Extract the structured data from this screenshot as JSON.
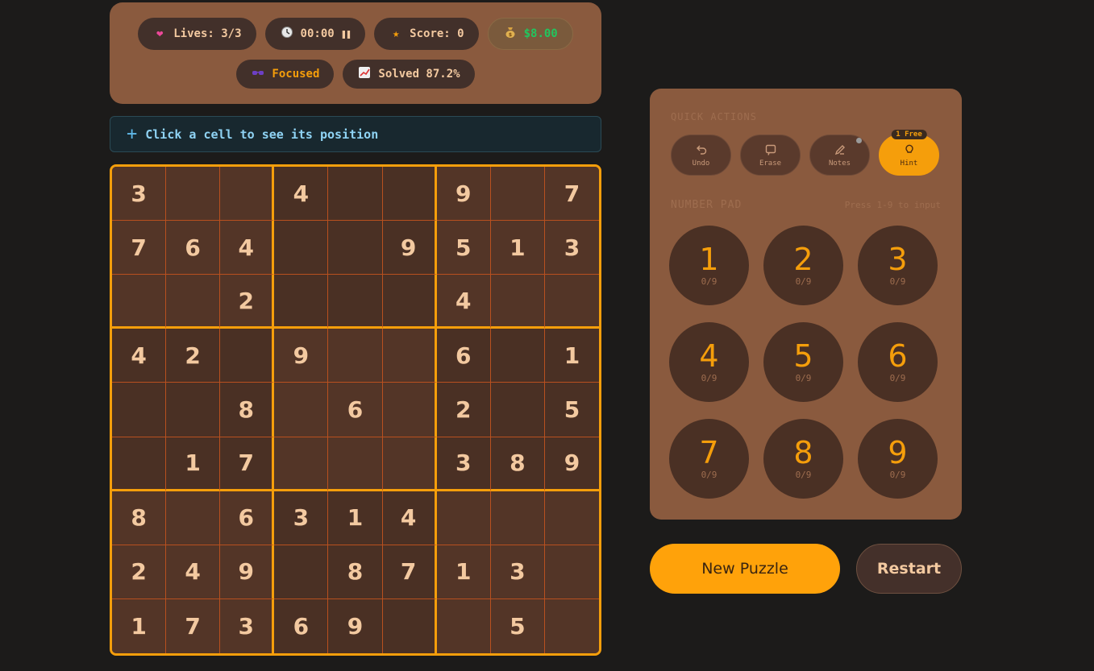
{
  "stats": {
    "lives": "Lives: 3/3",
    "timer": "00:00",
    "pause_icon": "pause-icon",
    "score": "Score: 0",
    "money": "$8.00",
    "mode": "Focused",
    "solved": "Solved 87.2%"
  },
  "info": {
    "text": "Click a cell to see its position"
  },
  "board": {
    "cells": [
      [
        "3",
        "",
        "",
        "4",
        "",
        "",
        "9",
        "",
        "7"
      ],
      [
        "7",
        "6",
        "4",
        "",
        "",
        "9",
        "5",
        "1",
        "3"
      ],
      [
        "",
        "",
        "2",
        "",
        "",
        "",
        "4",
        "",
        ""
      ],
      [
        "4",
        "2",
        "",
        "9",
        "",
        "",
        "6",
        "",
        "1"
      ],
      [
        "",
        "",
        "8",
        "",
        "6",
        "",
        "2",
        "",
        "5"
      ],
      [
        "",
        "1",
        "7",
        "",
        "",
        "",
        "3",
        "8",
        "9"
      ],
      [
        "8",
        "",
        "6",
        "3",
        "1",
        "4",
        "",
        "",
        ""
      ],
      [
        "2",
        "4",
        "9",
        "",
        "8",
        "7",
        "1",
        "3",
        ""
      ],
      [
        "1",
        "7",
        "3",
        "6",
        "9",
        "",
        "",
        "5",
        ""
      ]
    ]
  },
  "controls": {
    "quick_actions_label": "QUICK ACTIONS",
    "undo": "Undo",
    "erase": "Erase",
    "notes": "Notes",
    "hint": "Hint",
    "hint_badge": "1 Free",
    "number_pad_label": "NUMBER PAD",
    "number_pad_hint": "Press 1-9 to input",
    "numbers": [
      {
        "digit": "1",
        "count": "0/9"
      },
      {
        "digit": "2",
        "count": "0/9"
      },
      {
        "digit": "3",
        "count": "0/9"
      },
      {
        "digit": "4",
        "count": "0/9"
      },
      {
        "digit": "5",
        "count": "0/9"
      },
      {
        "digit": "6",
        "count": "0/9"
      },
      {
        "digit": "7",
        "count": "0/9"
      },
      {
        "digit": "8",
        "count": "0/9"
      },
      {
        "digit": "9",
        "count": "0/9"
      }
    ]
  },
  "buttons": {
    "new_puzzle": "New Puzzle",
    "restart": "Restart"
  },
  "colors": {
    "accent": "#f59e0b",
    "panel": "#8a5a3e",
    "background": "#1c1b1a"
  }
}
